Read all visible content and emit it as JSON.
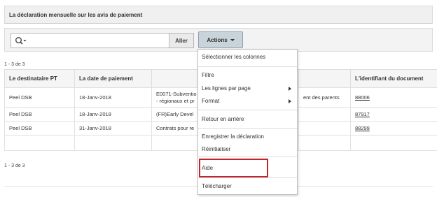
{
  "region": {
    "title": "La déclaration mensuelle sur les avis de paiement"
  },
  "toolbar": {
    "search_placeholder": "",
    "go_label": "Aller",
    "actions_label": "Actions"
  },
  "pagination": {
    "top": "1 - 3 de 3",
    "bottom": "1 - 3 de 3"
  },
  "table": {
    "headers": [
      "Le destinataire PT",
      "La date de paiement",
      "",
      "",
      "L'identifiant du document"
    ],
    "rows": [
      {
        "recipient": "Peel DSB",
        "date": "18-Janv-2018",
        "desc_line1": "E0071-Subventio",
        "desc_line2": "- régionaux et pr",
        "desc_right": "ent des parents",
        "doc_id": "88006"
      },
      {
        "recipient": "Peel DSB",
        "date": "18-Janv-2018",
        "desc_line1": "(FR)Early Devel",
        "desc_line2": "",
        "desc_right": "",
        "doc_id": "87917"
      },
      {
        "recipient": "Peel DSB",
        "date": "31-Janv-2018",
        "desc_line1": "Contrats pour re",
        "desc_line2": "",
        "desc_right": "",
        "doc_id": "88299"
      }
    ]
  },
  "menu": {
    "select_columns": "Sélectionner les colonnes",
    "filter": "Filtre",
    "rows_per_page": "Les lignes par page",
    "format": "Format",
    "flashback": "Retour en arrière",
    "save_report": "Enregistrer la déclaration",
    "reset": "Réinitialiser",
    "help": "Aide",
    "download": "Télécharger"
  },
  "colors": {
    "highlight": "#c0272d",
    "actions_bg": "#c9d3da"
  }
}
